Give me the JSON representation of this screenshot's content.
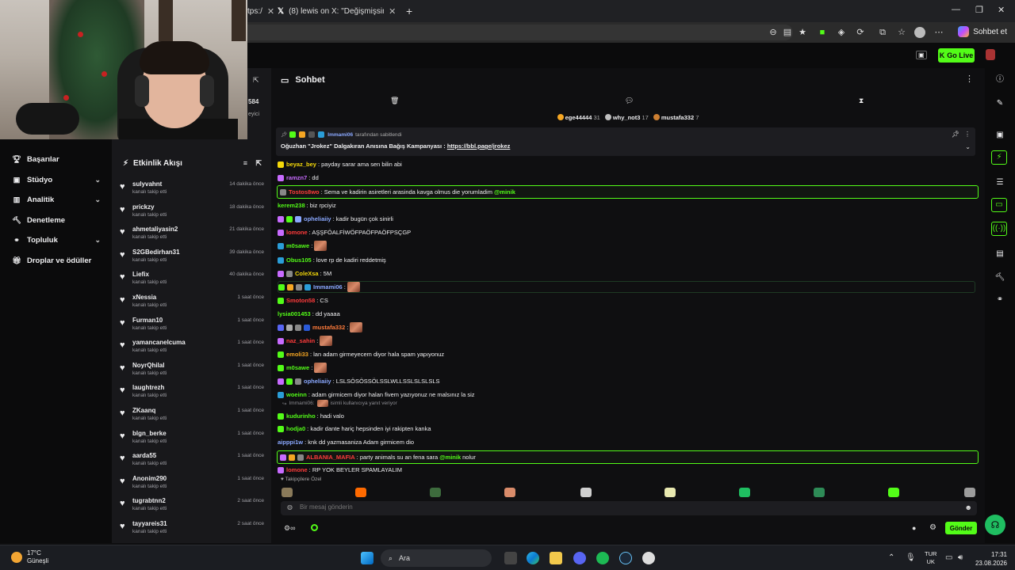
{
  "browser": {
    "tabs": [
      {
        "title": "tps:/",
        "close": "✕"
      },
      {
        "title": "(8) lewis on X: \"Değişmişsin... https:",
        "close": "✕"
      }
    ],
    "new_tab": "+",
    "copilot_label": "Sohbet et"
  },
  "kick": {
    "go_live": "Go Live"
  },
  "nav": {
    "items": [
      {
        "label": "Başarılar"
      },
      {
        "label": "Stüdyo"
      },
      {
        "label": "Analitik"
      },
      {
        "label": "Denetleme"
      },
      {
        "label": "Topluluk"
      },
      {
        "label": "Droplar ve ödüller"
      }
    ],
    "partial_value": "584",
    "partial_label": "eyici"
  },
  "events": {
    "title": "Etkinlik Akışı",
    "items": [
      {
        "name": "sulyvahnt",
        "sub": "kanalı takip etti",
        "time": "14 dakika önce"
      },
      {
        "name": "prickzy",
        "sub": "kanalı takip etti",
        "time": "18 dakika önce"
      },
      {
        "name": "ahmetaliyasin2",
        "sub": "kanalı takip etti",
        "time": "21 dakika önce"
      },
      {
        "name": "S2GBedirhan31",
        "sub": "kanalı takip etti",
        "time": "39 dakika önce"
      },
      {
        "name": "Liefix",
        "sub": "kanalı takip etti",
        "time": "40 dakika önce"
      },
      {
        "name": "xNessia",
        "sub": "kanalı takip etti",
        "time": "1 saat önce"
      },
      {
        "name": "Furman10",
        "sub": "kanalı takip etti",
        "time": "1 saat önce"
      },
      {
        "name": "yamancanelcuma",
        "sub": "kanalı takip etti",
        "time": "1 saat önce"
      },
      {
        "name": "NoyrQhilal",
        "sub": "kanalı takip etti",
        "time": "1 saat önce"
      },
      {
        "name": "laughtrezh",
        "sub": "kanalı takip etti",
        "time": "1 saat önce"
      },
      {
        "name": "ZKaanq",
        "sub": "kanalı takip etti",
        "time": "1 saat önce"
      },
      {
        "name": "blgn_berke",
        "sub": "kanalı takip etti",
        "time": "1 saat önce"
      },
      {
        "name": "aarda55",
        "sub": "kanalı takip etti",
        "time": "1 saat önce"
      },
      {
        "name": "Anonim290",
        "sub": "kanalı takip etti",
        "time": "1 saat önce"
      },
      {
        "name": "tugrabtnn2",
        "sub": "kanalı takip etti",
        "time": "2 saat önce"
      },
      {
        "name": "tayyareis31",
        "sub": "kanalı takip etti",
        "time": "2 saat önce"
      }
    ]
  },
  "chat": {
    "title": "Sohbet",
    "top_gifters": [
      {
        "name": "ege44444",
        "amount": "31",
        "color": "#f5a623"
      },
      {
        "name": "why_not3",
        "amount": "17",
        "color": "#c0c0c0"
      },
      {
        "name": "mustafa332",
        "amount": "7",
        "color": "#cd7f32"
      }
    ],
    "pinned": {
      "by_user": "Immami06",
      "by_suffix": "tarafından sabitlendi",
      "message": "Oğuzhan \"Jrokez\" Dalgakıran Anısına Bağış Kampanyası : ",
      "link": "https://bbl.page/jrokez"
    },
    "messages": [
      {
        "user": "beyaz_bey",
        "color": "#f5d90a",
        "text": ": payday sarar ama sen bilin abi"
      },
      {
        "user": "ramzn7",
        "color": "#c86bff",
        "text": ": dd"
      },
      {
        "user": "Tostos8wo",
        "color": "#ff3b3b",
        "text": ": Sema ve kadirin asiretleri arasinda kavga olmus die yorumladim ",
        "mention": "@minik"
      },
      {
        "user": "kerem238",
        "color": "#53fc18",
        "text": ": biz rpciyiz"
      },
      {
        "user": "opheliaiiy",
        "color": "#8aa8ff",
        "text": ": kadir bugün çok sinirli"
      },
      {
        "user": "lomone",
        "color": "#ff3b3b",
        "text": ": AŞŞFÖALFİWÖFPAÖFPAÖFPSÇGP"
      },
      {
        "user": "m0sawe",
        "color": "#53fc18",
        "text": ":"
      },
      {
        "user": "Obus105",
        "color": "#53fc18",
        "text": ": love rp de kadiri reddetmiş"
      },
      {
        "user": "ColeXsa",
        "color": "#f5d90a",
        "text": ": 5M"
      },
      {
        "user": "Immami06",
        "color": "#8aa8ff",
        "text": ":"
      },
      {
        "user": "Smoton58",
        "color": "#ff3b3b",
        "text": ": CS"
      },
      {
        "user": "lysia001453",
        "color": "#53fc18",
        "text": ": dd yaaaa"
      },
      {
        "user": "mustafa332",
        "color": "#ff7b3b",
        "text": ":"
      },
      {
        "user": "naz_sahin",
        "color": "#ff3b3b",
        "text": ":"
      },
      {
        "user": "emoli33",
        "color": "#f5a623",
        "text": ": lan adam girmeyecem diyor hala spam yapıyonuz"
      },
      {
        "user": "m0sawe",
        "color": "#53fc18",
        "text": ":"
      },
      {
        "user": "opheliaiiy",
        "color": "#8aa8ff",
        "text": ": LSLSÖSÖSSÖLSSLWLLSSLSLSLSLS"
      },
      {
        "user": "woeinn",
        "color": "#53fc18",
        "text": ": adam girmicem diyor halan fivem yazıyonuz ne malsınız la siz"
      },
      {
        "user": "kudurinho",
        "color": "#53fc18",
        "text": ": hadi valo"
      },
      {
        "user": "hodja0",
        "color": "#53fc18",
        "text": ": kadir dante hariç hepsinden iyi rakipten kanka"
      },
      {
        "user": "aipppi1w",
        "color": "#8aa8ff",
        "text": ": knk dd yazmasaniza Adam girmicem dio"
      },
      {
        "user": "ALBANIA_MAFIA",
        "color": "#ff3b3b",
        "text": ": party animals su an fena sara ",
        "mention": "@minik",
        "text2": " nolur"
      },
      {
        "user": "lomone",
        "color": "#ff3b3b",
        "text": ": RP YOK BEYLER SPAMLAYALIM"
      }
    ],
    "reply_hint": {
      "user": "Immami06:",
      "text": "isimli kullanıcıya yanıt veriyor"
    },
    "emote_label": "Takipçilere Özel",
    "input_placeholder": "Bir mesaj gönderin",
    "send_label": "Gönder"
  },
  "taskbar": {
    "temp": "17°C",
    "weather": "Güneşli",
    "search": "Ara",
    "lang_top": "TUR",
    "lang_bottom": "UK",
    "time": "17:31",
    "date": "23.08.2026"
  },
  "colors": {
    "accent": "#53fc18",
    "panel": "#18181b",
    "bg": "#0e0e10"
  }
}
